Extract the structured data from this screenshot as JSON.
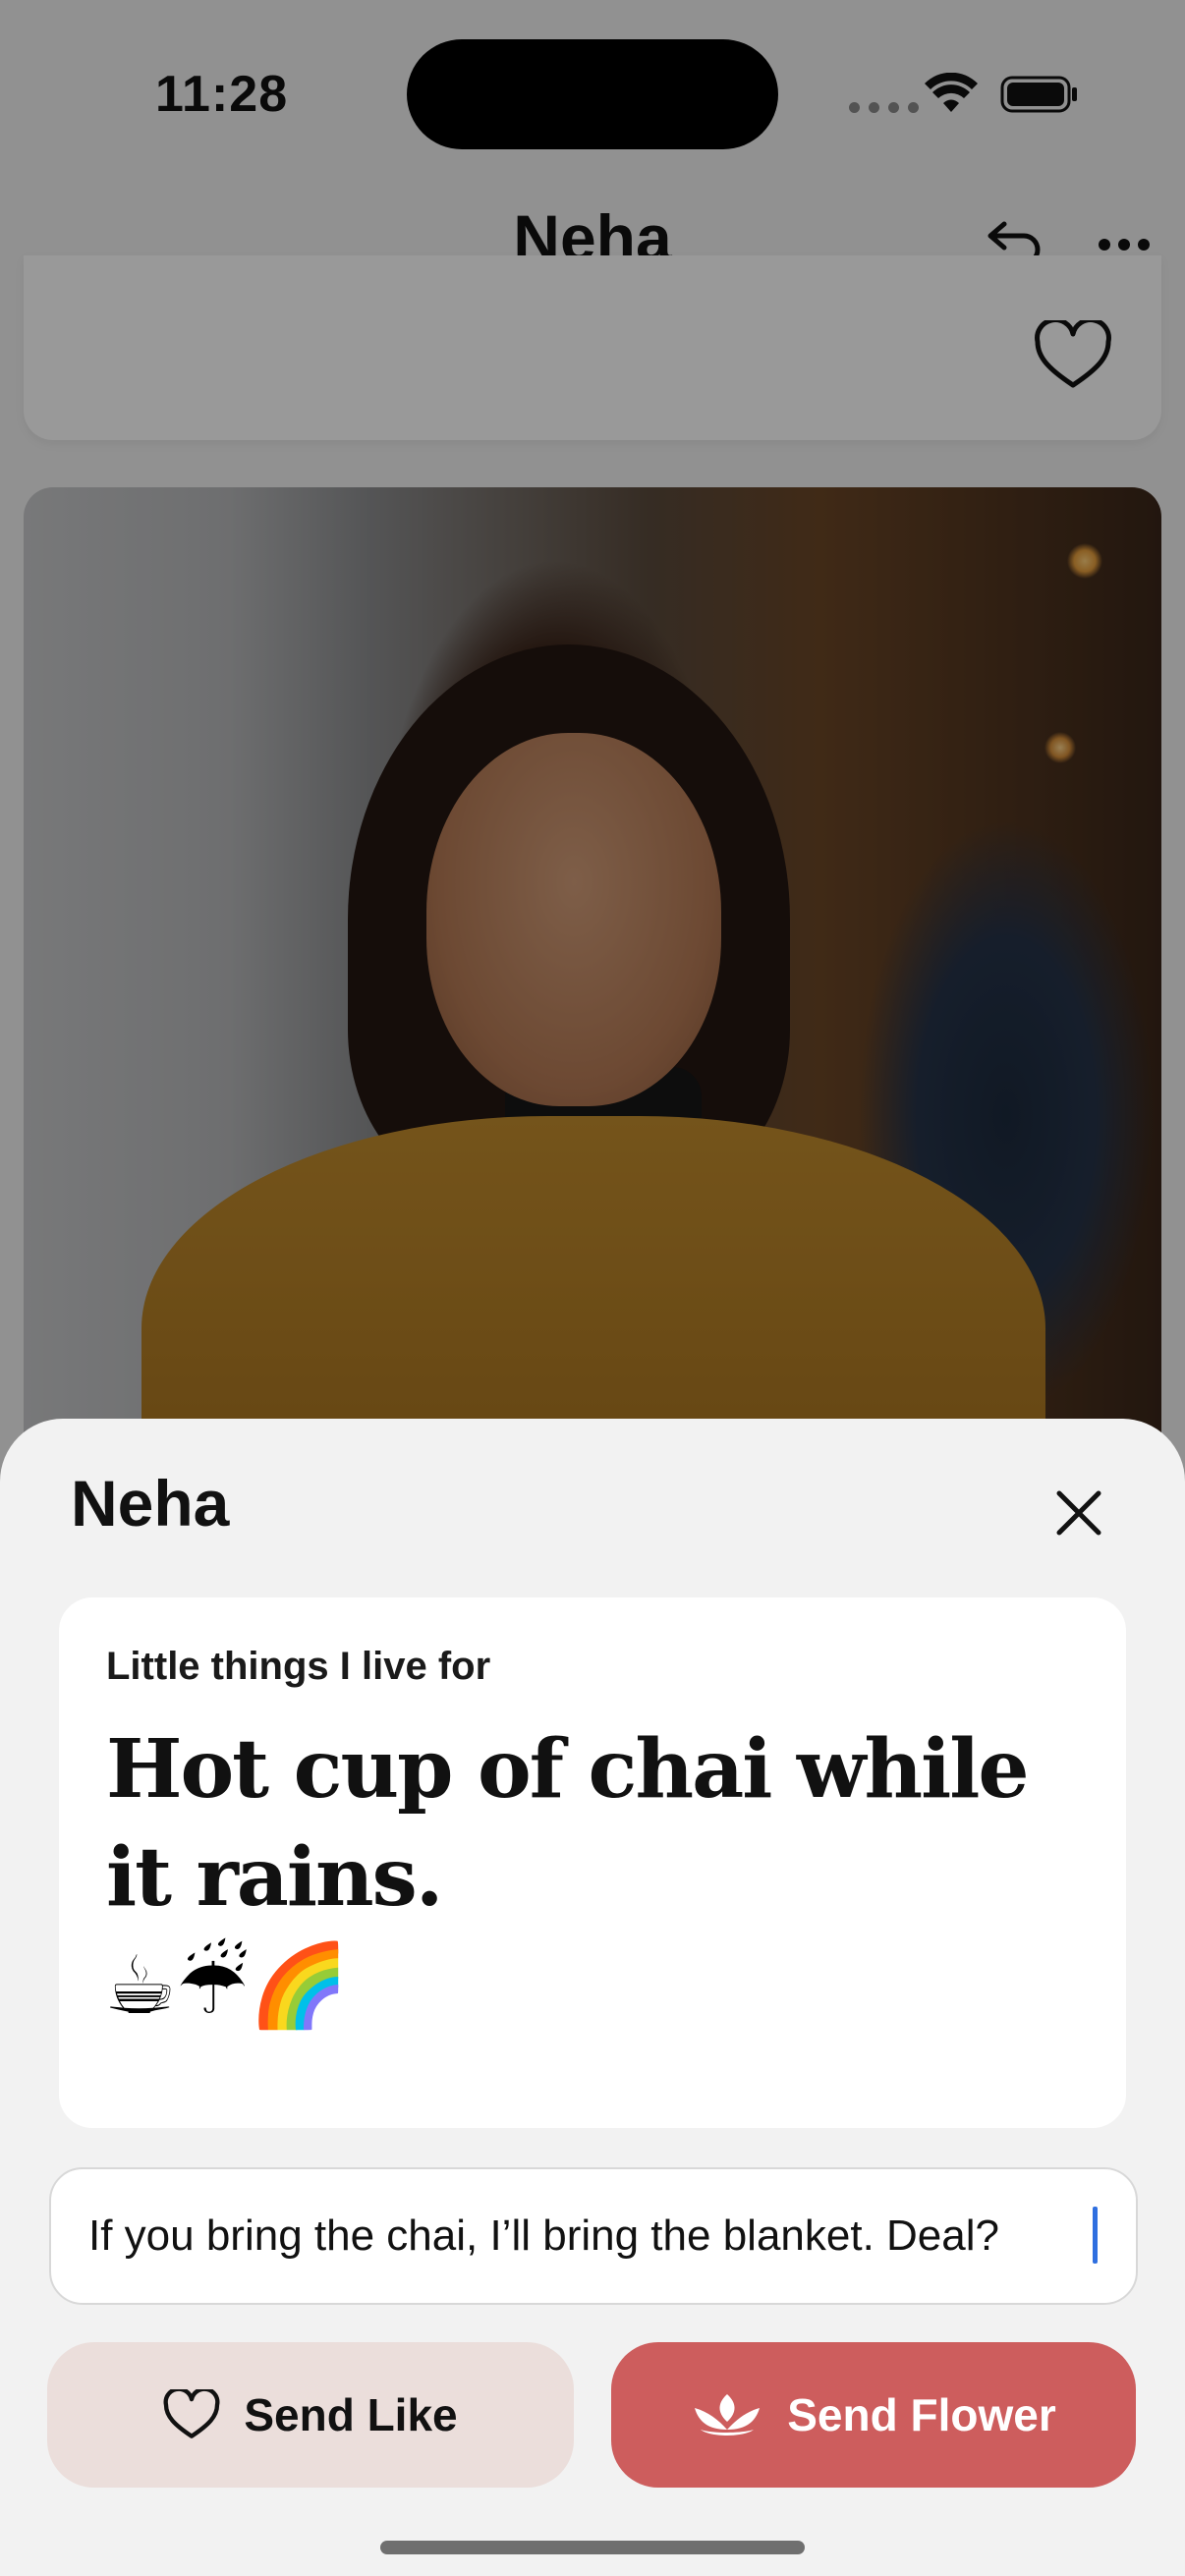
{
  "status_bar": {
    "time": "11:28"
  },
  "nav": {
    "title": "Neha",
    "undo_icon": "undo-icon",
    "more_icon": "more-icon"
  },
  "previous_card": {
    "like_icon": "heart-outline-icon"
  },
  "photo": {
    "description_icon": "profile-photo"
  },
  "sheet": {
    "title": "Neha",
    "close_icon": "close-icon",
    "prompt": {
      "question": "Little things I live for",
      "answer": "Hot cup of chai while it rains.",
      "emoji": "☕☔🌈"
    },
    "comment": {
      "value": "If you bring the chai, I’ll bring the blanket. Deal?"
    },
    "actions": {
      "like_label": "Send Like",
      "flower_label": "Send Flower"
    }
  },
  "colors": {
    "like_button_bg": "#ebdedb",
    "flower_button_bg": "#cd5d5d",
    "sheet_bg": "#f2f2f2",
    "cursor": "#2f6fe0"
  }
}
